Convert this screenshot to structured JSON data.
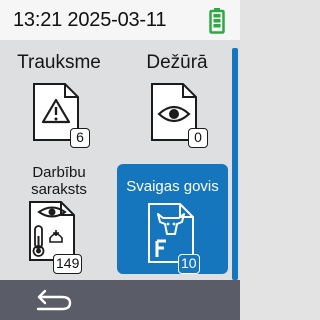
{
  "status": {
    "time": "13:21",
    "date": "2025-03-11",
    "battery_color": "#2ea844"
  },
  "tiles": [
    {
      "label": "Trauksme",
      "icon": "alert-icon",
      "count": "6",
      "active": false
    },
    {
      "label": "Dežūrā",
      "icon": "eye-icon",
      "count": "0",
      "active": false
    },
    {
      "label_lines": [
        "Darbību",
        "saraksts"
      ],
      "icon": "task-list-icon",
      "count": "149",
      "active": false
    },
    {
      "label": "Svaigas govis",
      "icon": "fresh-cow-icon",
      "count": "10",
      "active": true
    }
  ],
  "accent_color": "#1676bd",
  "bottom_bar": {
    "back_icon": "back-arrow-icon",
    "color": "#5a5c67"
  }
}
